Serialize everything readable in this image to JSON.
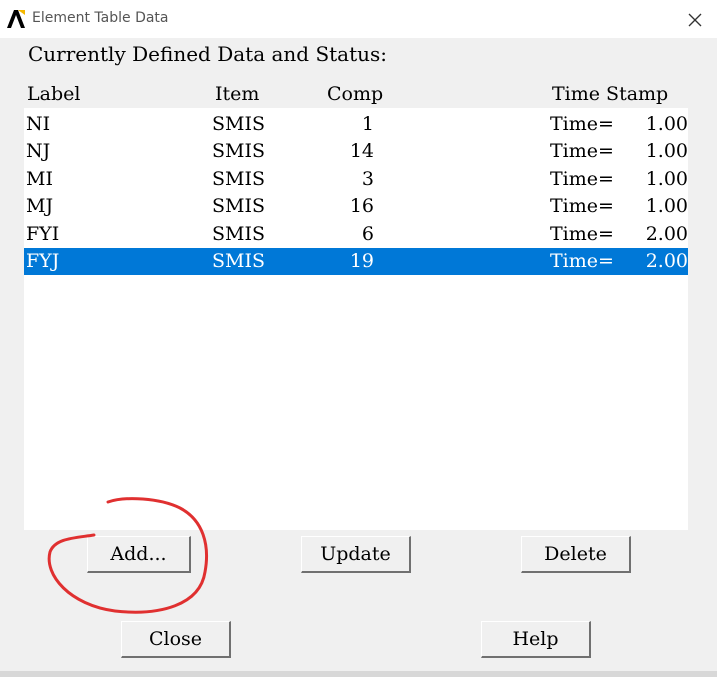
{
  "window": {
    "title": "Element Table Data"
  },
  "heading": "Currently Defined Data and Status:",
  "columns": {
    "label": "Label",
    "item": "Item",
    "comp": "Comp",
    "time_stamp": "Time Stamp"
  },
  "rows": [
    {
      "label": "NI",
      "item": "SMIS",
      "comp": "1",
      "time_label": "Time=",
      "time_value": "1.00"
    },
    {
      "label": "NJ",
      "item": "SMIS",
      "comp": "14",
      "time_label": "Time=",
      "time_value": "1.00"
    },
    {
      "label": "MI",
      "item": "SMIS",
      "comp": "3",
      "time_label": "Time=",
      "time_value": "1.00"
    },
    {
      "label": "MJ",
      "item": "SMIS",
      "comp": "16",
      "time_label": "Time=",
      "time_value": "1.00"
    },
    {
      "label": "FYI",
      "item": "SMIS",
      "comp": "6",
      "time_label": "Time=",
      "time_value": "2.00"
    },
    {
      "label": "FYJ",
      "item": "SMIS",
      "comp": "19",
      "time_label": "Time=",
      "time_value": "2.00"
    }
  ],
  "selected_row": "FYJ",
  "buttons": {
    "add": "Add...",
    "update": "Update",
    "delete": "Delete",
    "close": "Close",
    "help": "Help"
  },
  "colors": {
    "selection": "#0078d7",
    "annotation": "#e03030"
  }
}
